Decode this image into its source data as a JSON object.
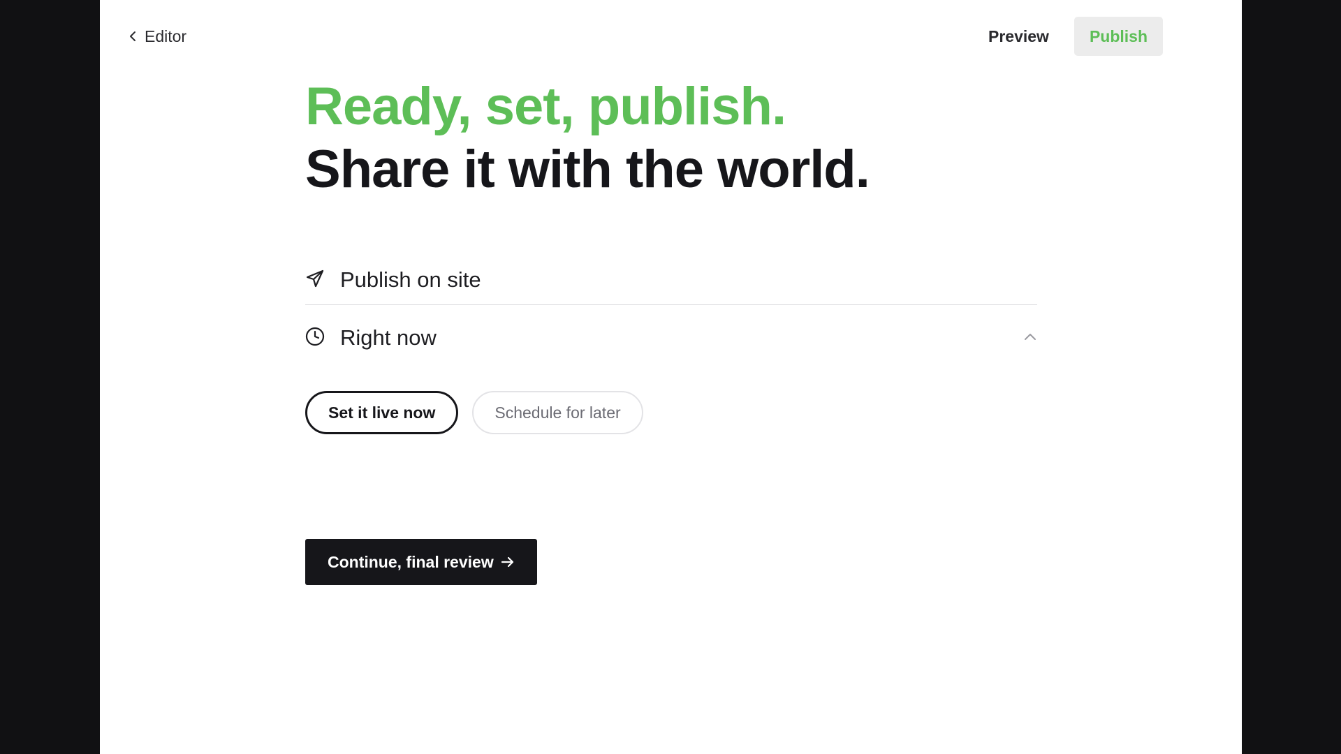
{
  "topbar": {
    "back_label": "Editor",
    "back_icon": "chevron-left-icon",
    "preview_label": "Preview",
    "publish_label": "Publish"
  },
  "hero": {
    "line1": "Ready, set, publish.",
    "line2": "Share it with the world."
  },
  "destination": {
    "icon": "send-icon",
    "label": "Publish on site"
  },
  "timing": {
    "icon": "clock-icon",
    "label": "Right now",
    "expanded": true,
    "options": [
      {
        "label": "Set it live now",
        "selected": true
      },
      {
        "label": "Schedule for later",
        "selected": false
      }
    ]
  },
  "cta": {
    "label": "Continue, final review",
    "icon": "arrow-right-icon"
  },
  "colors": {
    "accent": "#5dbe57",
    "dark": "#16161a",
    "background_outer": "#111113",
    "panel": "#ffffff"
  }
}
